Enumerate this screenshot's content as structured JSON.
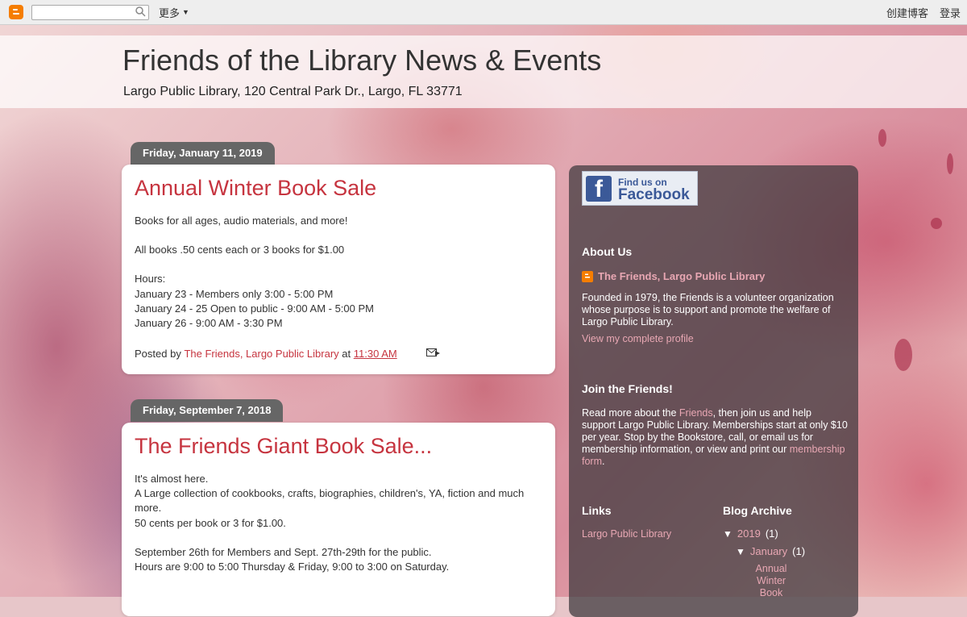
{
  "navbar": {
    "more_label": "更多",
    "create_blog_label": "创建博客",
    "login_label": "登录"
  },
  "header": {
    "title": "Friends of the Library News & Events",
    "description": "Largo Public Library, 120 Central Park Dr., Largo, FL 33771"
  },
  "posts": [
    {
      "date": "Friday, January 11, 2019",
      "title": "Annual Winter Book Sale",
      "body": [
        "Books for all ages, audio materials, and more!",
        "",
        "All books .50 cents each or 3 books for $1.00",
        "",
        "Hours:",
        "January 23 - Members only 3:00 - 5:00 PM",
        "January 24 - 25 Open to public - 9:00 AM - 5:00 PM",
        "January 26 - 9:00 AM - 3:30 PM"
      ],
      "posted_by_label": "Posted by",
      "author": "The Friends, Largo Public Library",
      "at_label": "at",
      "time": "11:30 AM"
    },
    {
      "date": "Friday, September 7, 2018",
      "title": "The Friends Giant Book Sale...",
      "body": [
        "It's almost here.",
        "A Large collection of cookbooks, crafts, biographies, children's, YA, fiction and much more.",
        "50 cents per book or 3 for $1.00.",
        "",
        "September 26th for Members and Sept. 27th-29th for the public.",
        "Hours are 9:00 to 5:00 Thursday & Friday, 9:00 to 3:00 on Saturday."
      ]
    }
  ],
  "sidebar": {
    "facebook_line1": "Find us on",
    "facebook_line2": "Facebook",
    "about_title": "About Us",
    "profile_name": "The Friends, Largo Public Library",
    "about_text": "Founded in 1979, the Friends is a volunteer organization whose purpose is to support and promote the welfare of Largo Public Library.",
    "view_profile": "View my complete profile",
    "join_title": "Join the Friends!",
    "join_text_1": "Read more about the ",
    "join_link_friends": "Friends",
    "join_text_2": ", then join us and help support Largo Public Library. Memberships start at only $10 per year. Stop by the Bookstore, call, or email us for membership information, or view and print our ",
    "join_link_form": "membership form",
    "join_text_3": ".",
    "links_title": "Links",
    "links": [
      "Largo Public Library"
    ],
    "archive_title": "Blog Archive",
    "archive_year": "2019",
    "archive_year_count": "(1)",
    "archive_month": "January",
    "archive_month_count": "(1)",
    "archive_post": "Annual Winter Book"
  }
}
